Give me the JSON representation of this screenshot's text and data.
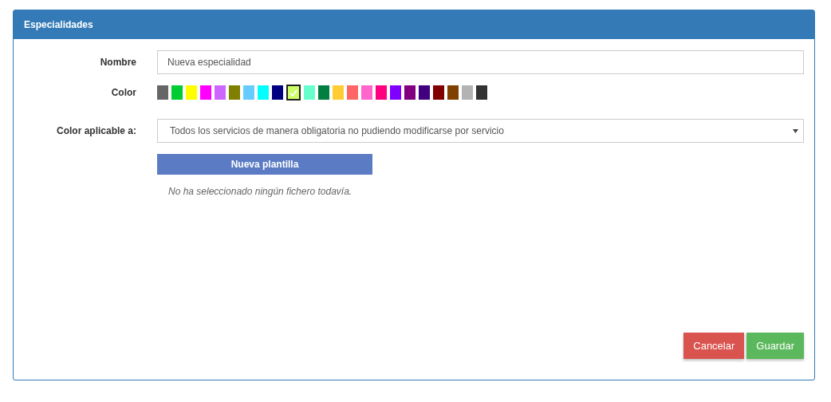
{
  "panel": {
    "title": "Especialidades"
  },
  "form": {
    "name_label": "Nombre",
    "name_value": "Nueva especialidad",
    "color_label": "Color",
    "colors": [
      {
        "color": "#666666",
        "selected": false
      },
      {
        "color": "#00cc33",
        "selected": false
      },
      {
        "color": "#ffff00",
        "selected": false
      },
      {
        "color": "#ff00ff",
        "selected": false
      },
      {
        "color": "#cc66ff",
        "selected": false
      },
      {
        "color": "#808000",
        "selected": false
      },
      {
        "color": "#66ccff",
        "selected": false
      },
      {
        "color": "#00ffff",
        "selected": false
      },
      {
        "color": "#000080",
        "selected": false
      },
      {
        "color": "#ccff66",
        "selected": true
      },
      {
        "color": "#66ffcc",
        "selected": false
      },
      {
        "color": "#008040",
        "selected": false
      },
      {
        "color": "#ffcc33",
        "selected": false
      },
      {
        "color": "#ff6666",
        "selected": false
      },
      {
        "color": "#ff66cc",
        "selected": false
      },
      {
        "color": "#ff0080",
        "selected": false
      },
      {
        "color": "#8000ff",
        "selected": false
      },
      {
        "color": "#800080",
        "selected": false
      },
      {
        "color": "#400080",
        "selected": false
      },
      {
        "color": "#800000",
        "selected": false
      },
      {
        "color": "#804000",
        "selected": false
      },
      {
        "color": "#b3b3b3",
        "selected": false
      },
      {
        "color": "#333333",
        "selected": false
      }
    ],
    "applies_label": "Color aplicable a:",
    "applies_value": "Todos los servicios de manera obligatoria no pudiendo modificarse por servicio",
    "template_button": "Nueva plantilla",
    "file_status": "No ha seleccionado ningún fichero todavía."
  },
  "buttons": [
    {
      "label": "Cancelar",
      "kind": "danger"
    },
    {
      "label": "Guardar",
      "kind": "success"
    }
  ]
}
